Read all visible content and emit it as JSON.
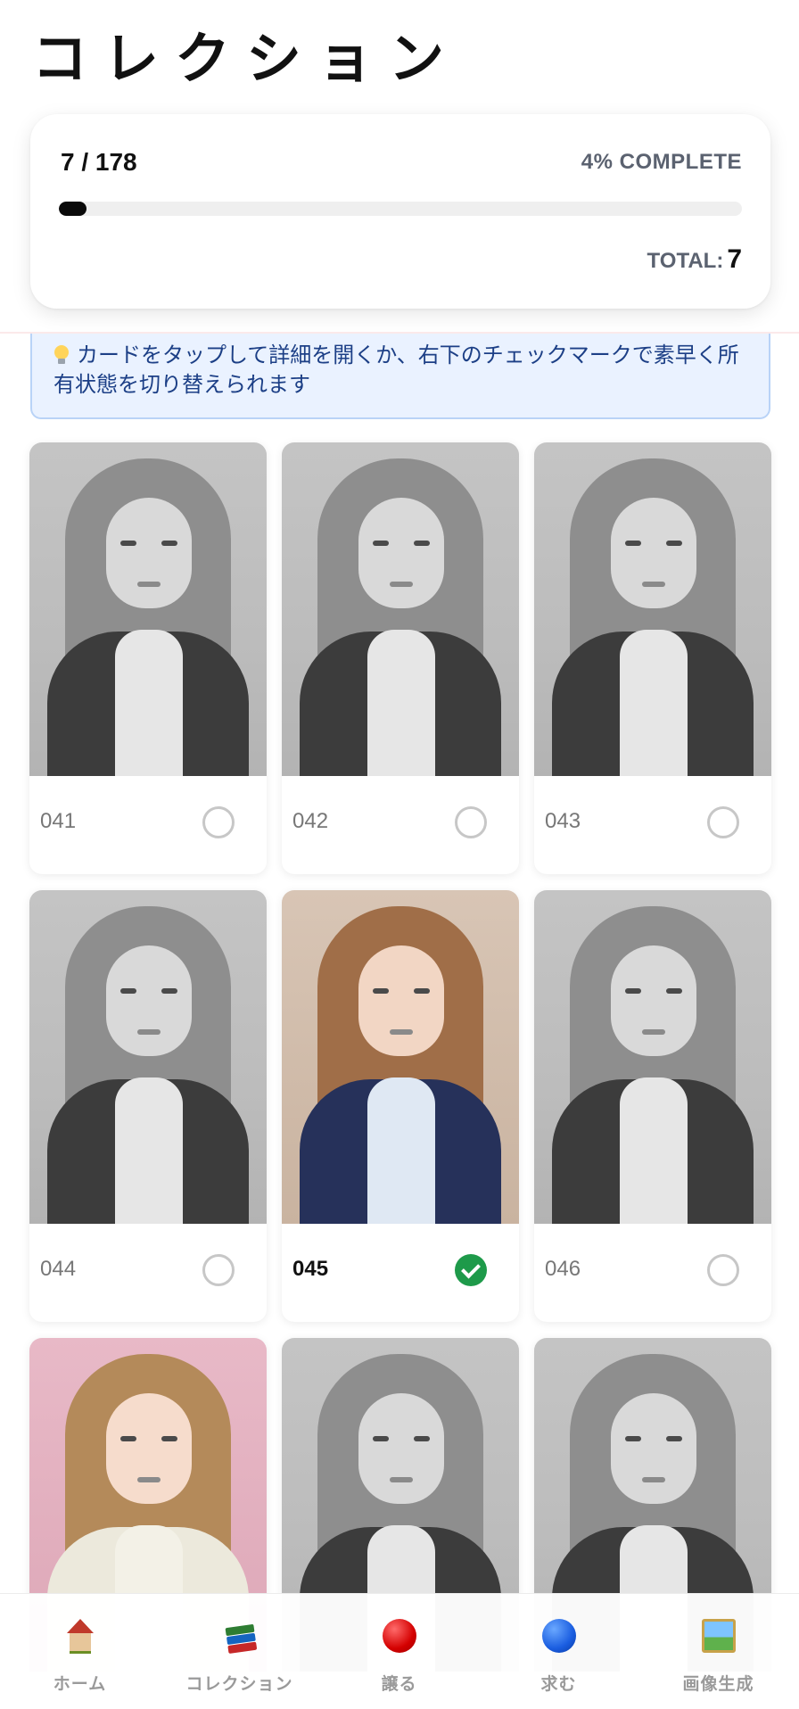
{
  "page": {
    "title": "コレクション"
  },
  "progress": {
    "count_label": "7 / 178",
    "owned": 7,
    "total_cards": 178,
    "fraction": 0.04,
    "percent_label": "4% COMPLETE",
    "total_label": "TOTAL:",
    "total_value": "7"
  },
  "tip": {
    "text": "カードをタップして詳細を開くか、右下のチェックマークで素早く所有状態を切り替えられます"
  },
  "cards": [
    {
      "number": "041",
      "owned": false
    },
    {
      "number": "042",
      "owned": false
    },
    {
      "number": "043",
      "owned": false
    },
    {
      "number": "044",
      "owned": false
    },
    {
      "number": "045",
      "owned": true
    },
    {
      "number": "046",
      "owned": false
    },
    {
      "number": "",
      "owned": false
    },
    {
      "number": "",
      "owned": false
    },
    {
      "number": "",
      "owned": false
    }
  ],
  "tabbar": {
    "items": [
      {
        "label": "ホーム",
        "icon": "house-icon"
      },
      {
        "label": "コレクション",
        "icon": "books-icon"
      },
      {
        "label": "譲る",
        "icon": "red-circle-icon"
      },
      {
        "label": "求む",
        "icon": "blue-circle-icon"
      },
      {
        "label": "画像生成",
        "icon": "framed-picture-icon"
      }
    ]
  },
  "colors": {
    "owned_check": "#1e9a4a",
    "tip_bg": "#eaf2ff",
    "tip_text": "#1c3f86",
    "progress_fill": "#0a0a0a"
  }
}
